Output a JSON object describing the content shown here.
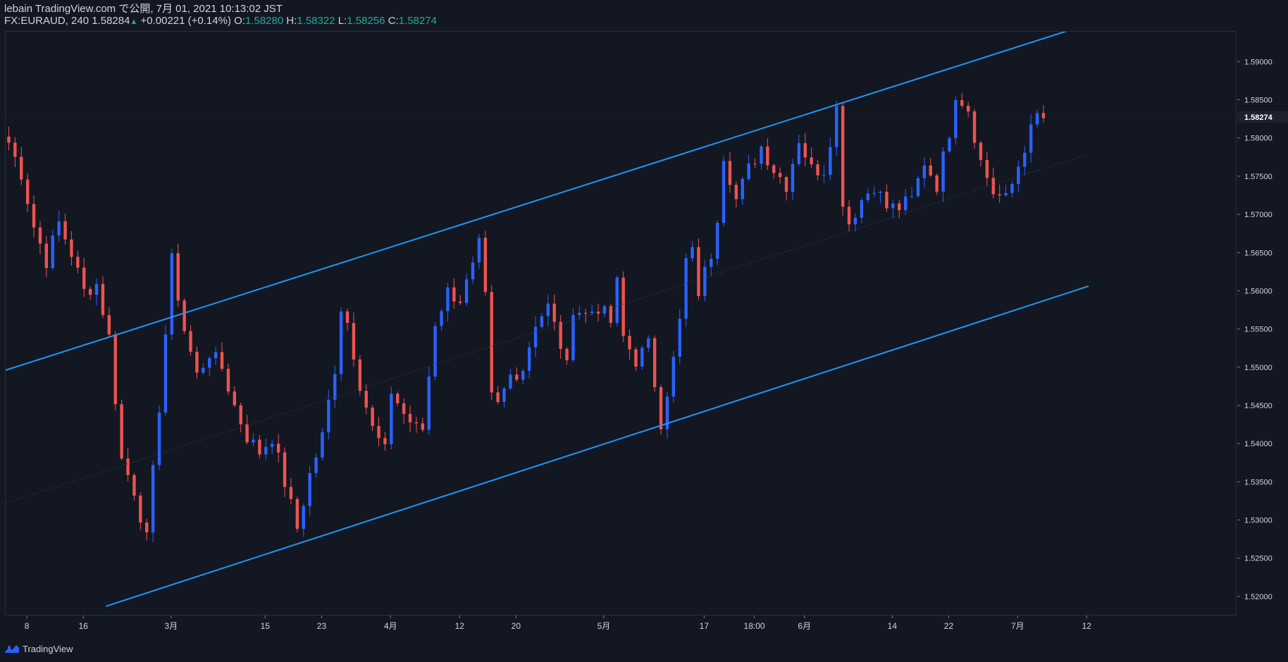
{
  "header": {
    "line1": "lebain TradingView.com で公開, 7月 01, 2021 10:13:02 JST",
    "symbol": "FX:EURAUD, 240",
    "last": "1.58284",
    "up_arrow": "▲",
    "change": "+0.00221 (+0.14%)",
    "o_label": "O:",
    "o_val": "1.58280",
    "h_label": "H:",
    "h_val": "1.58322",
    "l_label": "L:",
    "l_val": "1.58256",
    "c_label": "C:",
    "c_val": "1.58274"
  },
  "footer": {
    "brand": "TradingView",
    "logo_icon": "tradingview-logo-icon"
  },
  "colors": {
    "background": "#131722",
    "up": "#2962ff",
    "down": "#ef5350",
    "channel": "#2196f3",
    "text": "#d1d4dc",
    "ohlc_value": "#26a69a"
  },
  "chart_data": {
    "type": "candlestick",
    "symbol": "FX:EURAUD",
    "interval": "240",
    "ylim": [
      1.5175,
      1.594
    ],
    "y_ticks": [
      "1.52000",
      "1.52500",
      "1.53000",
      "1.53500",
      "1.54000",
      "1.54500",
      "1.55000",
      "1.55500",
      "1.56000",
      "1.56500",
      "1.57000",
      "1.57500",
      "1.58000",
      "1.58500",
      "1.59000"
    ],
    "current_price_label": "1.58274",
    "current_price": 1.58274,
    "x_ticks": [
      {
        "label": "8",
        "i": 3
      },
      {
        "label": "16",
        "i": 12
      },
      {
        "label": "3月",
        "i": 26
      },
      {
        "label": "15",
        "i": 41
      },
      {
        "label": "23",
        "i": 50
      },
      {
        "label": "4月",
        "i": 61
      },
      {
        "label": "12",
        "i": 72
      },
      {
        "label": "20",
        "i": 81
      },
      {
        "label": "5月",
        "i": 95
      },
      {
        "label": "17",
        "i": 111
      },
      {
        "label": "18:00",
        "i": 119
      },
      {
        "label": "6月",
        "i": 127
      },
      {
        "label": "14",
        "i": 141
      },
      {
        "label": "22",
        "i": 150
      },
      {
        "label": "7月",
        "i": 161
      },
      {
        "label": "12",
        "i": 172
      }
    ],
    "close_anchors": [
      [
        0,
        1.5795
      ],
      [
        2,
        1.5755
      ],
      [
        4,
        1.5685
      ],
      [
        6,
        1.564
      ],
      [
        8,
        1.569
      ],
      [
        10,
        1.565
      ],
      [
        12,
        1.56
      ],
      [
        14,
        1.561
      ],
      [
        16,
        1.554
      ],
      [
        18,
        1.538
      ],
      [
        20,
        1.534
      ],
      [
        22,
        1.5275
      ],
      [
        24,
        1.545
      ],
      [
        26,
        1.564
      ],
      [
        28,
        1.555
      ],
      [
        30,
        1.549
      ],
      [
        32,
        1.552
      ],
      [
        34,
        1.55
      ],
      [
        36,
        1.545
      ],
      [
        38,
        1.541
      ],
      [
        40,
        1.539
      ],
      [
        42,
        1.541
      ],
      [
        44,
        1.535
      ],
      [
        46,
        1.529
      ],
      [
        48,
        1.536
      ],
      [
        50,
        1.541
      ],
      [
        52,
        1.55
      ],
      [
        53,
        1.558
      ],
      [
        54,
        1.556
      ],
      [
        56,
        1.548
      ],
      [
        58,
        1.542
      ],
      [
        60,
        1.539
      ],
      [
        61,
        1.547
      ],
      [
        63,
        1.544
      ],
      [
        65,
        1.542
      ],
      [
        66,
        1.542
      ],
      [
        68,
        1.556
      ],
      [
        70,
        1.56
      ],
      [
        72,
        1.559
      ],
      [
        74,
        1.563
      ],
      [
        75,
        1.566
      ],
      [
        76,
        1.559
      ],
      [
        77,
        1.546
      ],
      [
        78,
        1.545
      ],
      [
        80,
        1.549
      ],
      [
        82,
        1.55
      ],
      [
        84,
        1.556
      ],
      [
        86,
        1.558
      ],
      [
        88,
        1.553
      ],
      [
        89,
        1.55
      ],
      [
        90,
        1.558
      ],
      [
        92,
        1.557
      ],
      [
        94,
        1.558
      ],
      [
        96,
        1.556
      ],
      [
        97,
        1.561
      ],
      [
        98,
        1.554
      ],
      [
        100,
        1.551
      ],
      [
        102,
        1.553
      ],
      [
        103,
        1.548
      ],
      [
        104,
        1.543
      ],
      [
        106,
        1.551
      ],
      [
        107,
        1.556
      ],
      [
        108,
        1.564
      ],
      [
        109,
        1.565
      ],
      [
        110,
        1.56
      ],
      [
        112,
        1.565
      ],
      [
        113,
        1.57
      ],
      [
        114,
        1.578
      ],
      [
        116,
        1.572
      ],
      [
        118,
        1.576
      ],
      [
        120,
        1.579
      ],
      [
        122,
        1.576
      ],
      [
        124,
        1.574
      ],
      [
        126,
        1.58
      ],
      [
        128,
        1.576
      ],
      [
        130,
        1.576
      ],
      [
        132,
        1.584
      ],
      [
        133,
        1.572
      ],
      [
        134,
        1.569
      ],
      [
        136,
        1.572
      ],
      [
        138,
        1.574
      ],
      [
        140,
        1.571
      ],
      [
        142,
        1.571
      ],
      [
        144,
        1.572
      ],
      [
        146,
        1.577
      ],
      [
        148,
        1.574
      ],
      [
        150,
        1.581
      ],
      [
        151,
        1.586
      ],
      [
        153,
        1.584
      ],
      [
        155,
        1.577
      ],
      [
        157,
        1.573
      ],
      [
        159,
        1.572
      ],
      [
        160,
        1.574
      ],
      [
        162,
        1.579
      ],
      [
        164,
        1.583
      ],
      [
        165,
        1.5827
      ]
    ],
    "candle_count": 166,
    "channel_lines": [
      {
        "name": "upper",
        "from": {
          "i": 0,
          "p": 1.5497
        },
        "to": {
          "i": 170.8,
          "p": 1.5945
        }
      },
      {
        "name": "middle",
        "from": {
          "i": 0,
          "p": 1.5323
        },
        "to": {
          "i": 172.7,
          "p": 1.578
        }
      },
      {
        "name": "lower",
        "from": {
          "i": 16,
          "p": 1.5188
        },
        "to": {
          "i": 172.7,
          "p": 1.5607
        }
      }
    ]
  }
}
